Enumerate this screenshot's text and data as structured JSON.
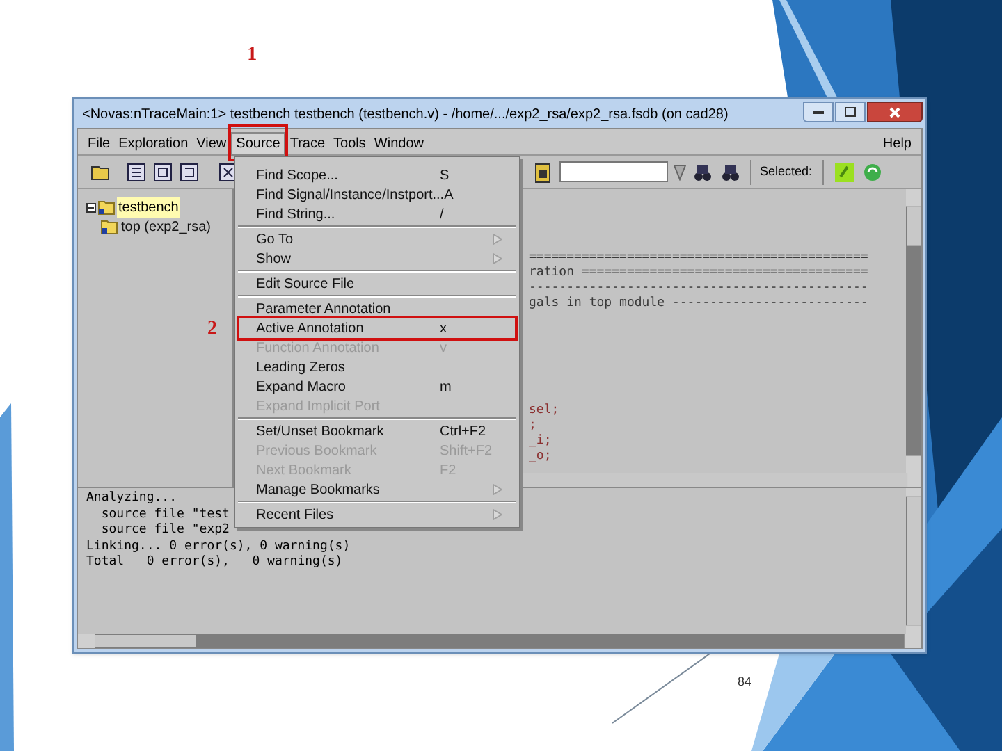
{
  "window": {
    "title": "<Novas:nTraceMain:1> testbench testbench (testbench.v) - /home/.../exp2_rsa/exp2_rsa.fsdb (on cad28)"
  },
  "menu_bar": [
    {
      "label": "File",
      "selected": false
    },
    {
      "label": "Exploration",
      "selected": false
    },
    {
      "label": "View",
      "selected": false
    },
    {
      "label": "Source",
      "selected": true,
      "marker": "1"
    },
    {
      "label": "Trace",
      "selected": false
    },
    {
      "label": "Tools",
      "selected": false
    },
    {
      "label": "Window",
      "selected": false
    },
    {
      "label": "Help",
      "selected": false
    }
  ],
  "toolbar": {
    "selected_label": "Selected:"
  },
  "tree": [
    {
      "label": "testbench",
      "selected": true,
      "expanded": true,
      "children": [
        {
          "label": "top (exp2_rsa)",
          "selected": false
        }
      ]
    }
  ],
  "source_lines": [
    {
      "kind": "blank"
    },
    {
      "kind": "blank"
    },
    {
      "kind": "comment",
      "text": "============================================="
    },
    {
      "kind": "comment",
      "text": "ration ======================================"
    },
    {
      "kind": "comment",
      "text": "---------------------------------------------"
    },
    {
      "kind": "comment",
      "text": "gals in top module --------------------------"
    },
    {
      "kind": "blank"
    },
    {
      "kind": "blank"
    },
    {
      "kind": "blank"
    },
    {
      "kind": "blank"
    },
    {
      "kind": "blank"
    },
    {
      "kind": "blank"
    },
    {
      "kind": "code",
      "text": "sel;"
    },
    {
      "kind": "code",
      "text": ";"
    },
    {
      "kind": "code",
      "text": "_i;"
    },
    {
      "kind": "code",
      "text": "_o;"
    }
  ],
  "log_lines": [
    "Analyzing...",
    "  source file \"test",
    "  source file \"exp2",
    "Linking... 0 error(s), 0 warning(s)",
    "Total   0 error(s),   0 warning(s)"
  ],
  "source_menu": [
    {
      "kind": "item",
      "label": "Find Scope...",
      "shortcut": "S",
      "disabled": false,
      "submenu": false
    },
    {
      "kind": "item",
      "label": "Find Signal/Instance/Instport...",
      "shortcut": "A",
      "disabled": false,
      "submenu": false
    },
    {
      "kind": "item",
      "label": "Find String...",
      "shortcut": "/",
      "disabled": false,
      "submenu": false
    },
    {
      "kind": "separator"
    },
    {
      "kind": "item",
      "label": "Go To",
      "disabled": false,
      "submenu": true
    },
    {
      "kind": "item",
      "label": "Show",
      "disabled": false,
      "submenu": true
    },
    {
      "kind": "separator"
    },
    {
      "kind": "item",
      "label": "Edit Source File",
      "disabled": false,
      "submenu": false
    },
    {
      "kind": "separator"
    },
    {
      "kind": "item",
      "label": "Parameter Annotation",
      "disabled": false,
      "submenu": false
    },
    {
      "kind": "item",
      "label": "Active Annotation",
      "shortcut": "x",
      "disabled": false,
      "submenu": false,
      "marker": "2"
    },
    {
      "kind": "item",
      "label": "Function Annotation",
      "shortcut": "v",
      "disabled": true,
      "submenu": false
    },
    {
      "kind": "item",
      "label": "Leading Zeros",
      "disabled": false,
      "submenu": false
    },
    {
      "kind": "item",
      "label": "Expand Macro",
      "shortcut": "m",
      "disabled": false,
      "submenu": false
    },
    {
      "kind": "item",
      "label": "Expand Implicit Port",
      "disabled": true,
      "submenu": false
    },
    {
      "kind": "separator"
    },
    {
      "kind": "item",
      "label": "Set/Unset Bookmark",
      "shortcut": "Ctrl+F2",
      "disabled": false,
      "submenu": false
    },
    {
      "kind": "item",
      "label": "Previous Bookmark",
      "shortcut": "Shift+F2",
      "disabled": true,
      "submenu": false
    },
    {
      "kind": "item",
      "label": "Next Bookmark",
      "shortcut": "F2",
      "disabled": true,
      "submenu": false
    },
    {
      "kind": "item",
      "label": "Manage Bookmarks",
      "disabled": false,
      "submenu": true
    },
    {
      "kind": "separator"
    },
    {
      "kind": "item",
      "label": "Recent Files",
      "disabled": false,
      "submenu": true
    }
  ],
  "slide": {
    "page_number": "84"
  }
}
